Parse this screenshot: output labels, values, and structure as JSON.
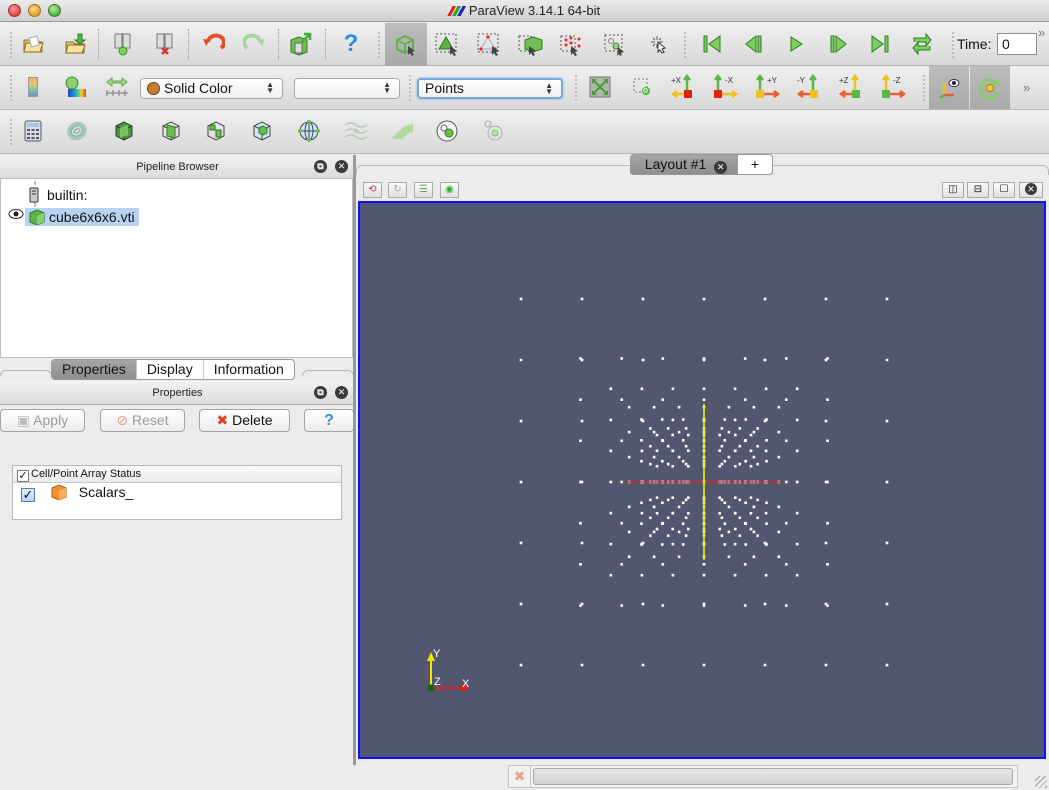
{
  "window": {
    "title": "ParaView 3.14.1 64-bit"
  },
  "toolbar_main": {
    "buttons": [
      {
        "name": "open-file",
        "icon": "folder-open-icon"
      },
      {
        "name": "load-state",
        "icon": "folder-load-icon"
      },
      {
        "name": "connect",
        "icon": "server-connect-icon"
      },
      {
        "name": "disconnect",
        "icon": "server-disconnect-icon"
      },
      {
        "name": "undo",
        "icon": "undo-icon"
      },
      {
        "name": "redo",
        "icon": "redo-icon"
      },
      {
        "name": "save-data",
        "icon": "save-data-icon"
      },
      {
        "name": "help",
        "icon": "help-icon"
      },
      {
        "name": "interact",
        "icon": "interact-cube-icon",
        "active": true
      },
      {
        "name": "select-cells-on",
        "icon": "select-cells-on-icon"
      },
      {
        "name": "select-points-on",
        "icon": "select-points-on-icon"
      },
      {
        "name": "select-cells-through",
        "icon": "select-cells-through-icon"
      },
      {
        "name": "select-points-through",
        "icon": "select-points-through-icon"
      },
      {
        "name": "select-block",
        "icon": "select-block-icon"
      },
      {
        "name": "clear-selection",
        "icon": "clear-selection-icon"
      }
    ],
    "vcr": [
      {
        "name": "first-frame",
        "icon": "first-frame-icon"
      },
      {
        "name": "previous-frame",
        "icon": "previous-frame-icon"
      },
      {
        "name": "play",
        "icon": "play-icon"
      },
      {
        "name": "next-frame",
        "icon": "next-frame-icon"
      },
      {
        "name": "last-frame",
        "icon": "last-frame-icon"
      },
      {
        "name": "loop",
        "icon": "loop-icon"
      }
    ],
    "time_label": "Time:",
    "time_value": "0",
    "overflow_label": "»"
  },
  "toolbar_display": {
    "color_by_value": "Solid Color",
    "color_component_value": "",
    "representation_value": "Points",
    "camera_buttons": [
      "+X",
      "-X",
      "+Y",
      "-Y",
      "+Z",
      "-Z"
    ],
    "overflow_label": "»"
  },
  "toolbar_filters": {
    "buttons": [
      {
        "name": "calculator",
        "icon": "calculator-icon"
      },
      {
        "name": "contour",
        "icon": "contour-icon"
      },
      {
        "name": "clip",
        "icon": "clip-icon"
      },
      {
        "name": "slice",
        "icon": "slice-icon"
      },
      {
        "name": "threshold",
        "icon": "threshold-icon"
      },
      {
        "name": "extract-subset",
        "icon": "extract-subset-icon"
      },
      {
        "name": "glyph",
        "icon": "glyph-icon"
      },
      {
        "name": "stream-tracer",
        "icon": "stream-tracer-icon"
      },
      {
        "name": "warp-by-vector",
        "icon": "warp-icon"
      },
      {
        "name": "group-datasets",
        "icon": "group-datasets-icon"
      },
      {
        "name": "extract-level",
        "icon": "extract-level-icon"
      }
    ]
  },
  "pipeline_browser": {
    "title": "Pipeline Browser",
    "items": [
      {
        "label": "builtin:",
        "icon": "server-icon",
        "selected": false
      },
      {
        "label": "cube6x6x6.vti",
        "icon": "green-cube-icon",
        "selected": true,
        "visible": true
      }
    ]
  },
  "object_inspector": {
    "tabs": [
      {
        "label": "Properties",
        "active": true
      },
      {
        "label": "Display",
        "active": false
      },
      {
        "label": "Information",
        "active": false
      }
    ],
    "title": "Properties",
    "buttons": {
      "apply": "Apply",
      "reset": "Reset",
      "delete": "Delete",
      "help": "?"
    },
    "array_status": {
      "header": "Cell/Point Array Status",
      "header_checked": true,
      "rows": [
        {
          "label": "Scalars_",
          "checked": true
        }
      ]
    }
  },
  "layout": {
    "tab_label": "Layout #1",
    "new_tab_label": "+"
  },
  "viewport": {
    "background": "#52566e",
    "border_color": "#1010ff",
    "grid_points_per_axis": 7,
    "point_color": "#ffffff",
    "axes": {
      "x_label": "X",
      "y_label": "Y",
      "z_label": "Z",
      "x_color": "#dd2222",
      "y_color": "#e8e800",
      "z_color": "#116611"
    },
    "center_axes": {
      "x_color": "#d22a2a",
      "y_color": "#f2f200"
    }
  },
  "status": {
    "progress": 0
  }
}
